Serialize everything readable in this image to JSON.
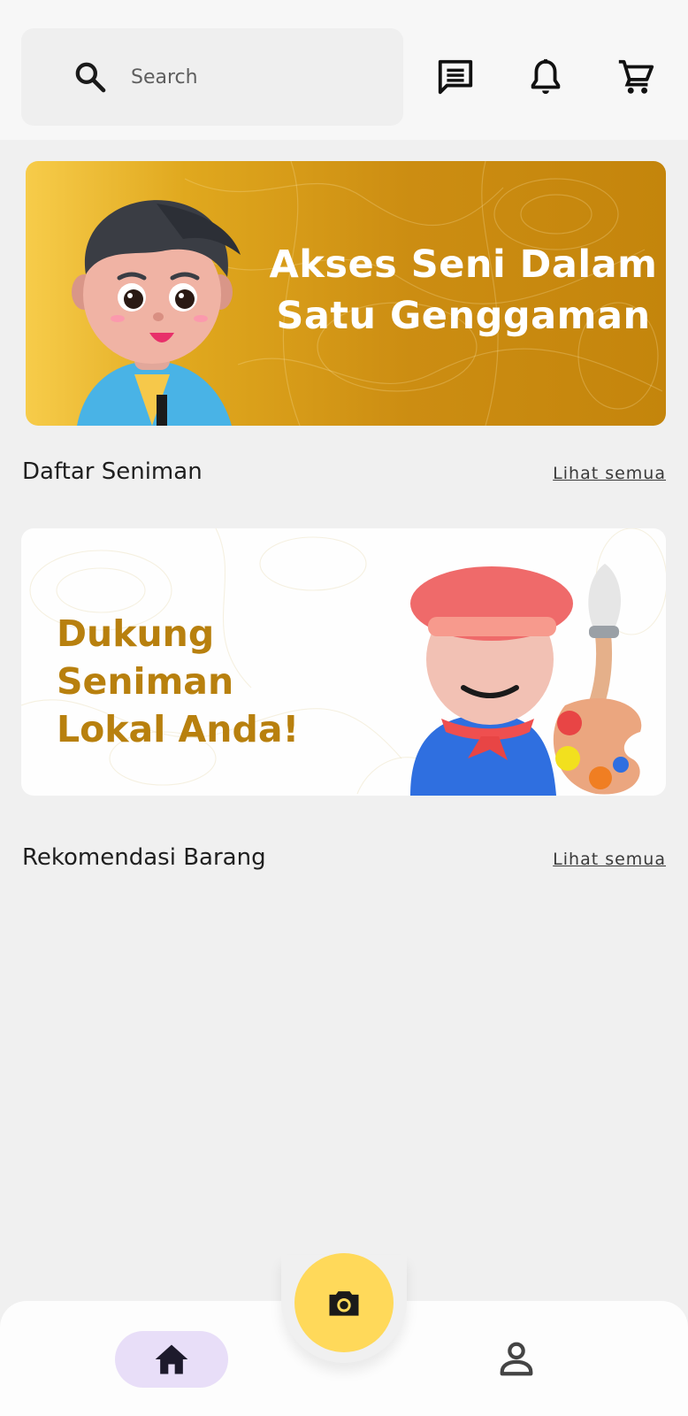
{
  "header": {
    "search": {
      "placeholder": "Search",
      "value": ""
    },
    "icons": [
      "search-icon",
      "chat-icon",
      "bell-icon",
      "cart-icon"
    ]
  },
  "banner_top": {
    "title_line1": "Akses Seni Dalam",
    "title_line2": "Satu Genggaman"
  },
  "section_artists": {
    "title": "Daftar Seniman",
    "see_all": "Lihat semua"
  },
  "banner_support": {
    "title_line1": "Dukung Seniman",
    "title_line2": "Lokal Anda!"
  },
  "section_products": {
    "title": "Rekomendasi Barang",
    "see_all": "Lihat semua"
  },
  "bottom_nav": {
    "items": [
      {
        "id": "home",
        "icon": "home-icon",
        "active": true
      },
      {
        "id": "camera",
        "icon": "camera-icon"
      },
      {
        "id": "profile",
        "icon": "person-icon"
      }
    ]
  },
  "colors": {
    "background": "#f0f0f0",
    "banner_gold": "#c98a10",
    "banner_text_gold": "#b8800e",
    "fab_yellow": "#ffd95a",
    "nav_active": "#e8def8"
  }
}
